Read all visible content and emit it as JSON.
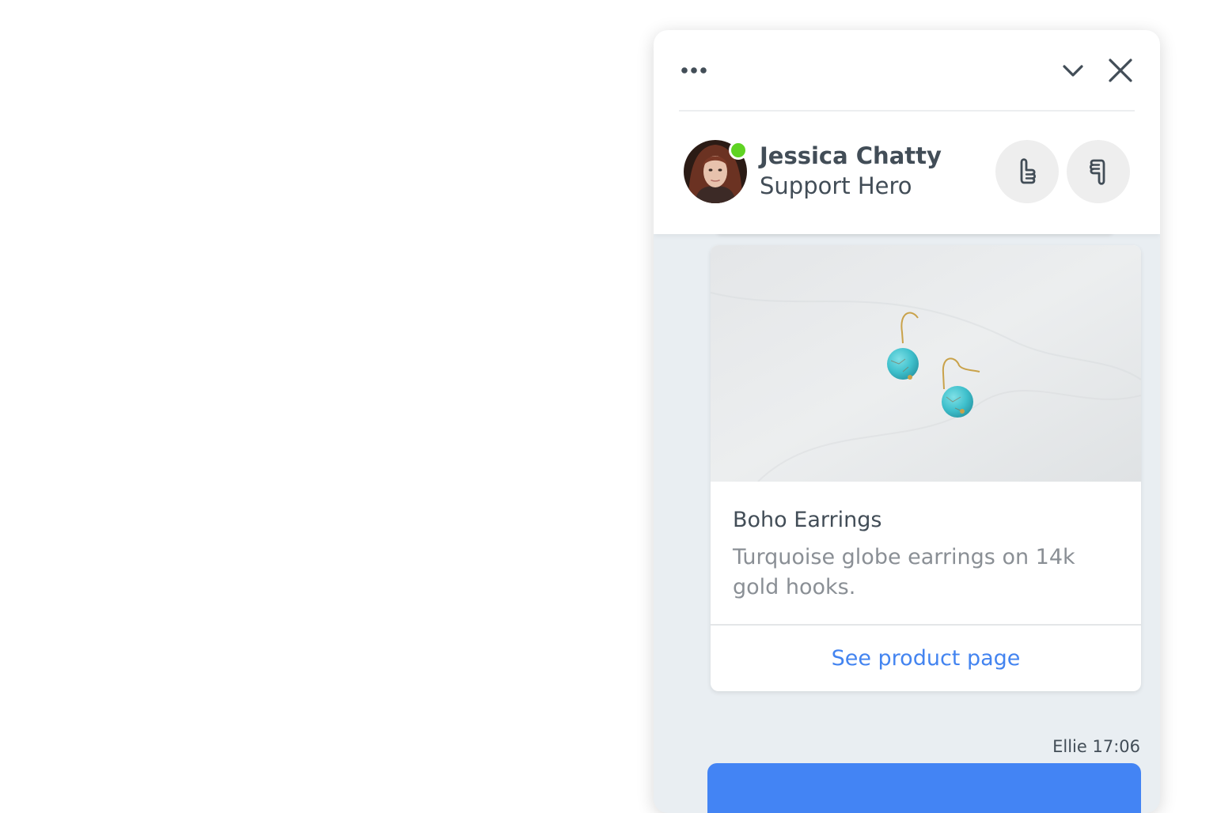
{
  "header": {
    "menu_icon": "more-horizontal-icon",
    "minimize_icon": "chevron-down-icon",
    "close_icon": "close-icon"
  },
  "agent": {
    "name": "Jessica Chatty",
    "role": "Support Hero",
    "status": "online",
    "status_color": "#5fd323"
  },
  "rating": {
    "thumbs_up_icon": "thumbs-up-icon",
    "thumbs_down_icon": "thumbs-down-icon"
  },
  "product_card": {
    "title": "Boho Earrings",
    "description": "Turquoise globe earrings on 14k gold hooks.",
    "link_label": "See product page"
  },
  "message": {
    "meta": "Ellie 17:06"
  },
  "colors": {
    "accent": "#4384f4",
    "text_primary": "#424d57",
    "text_secondary": "#8a8f95",
    "chat_background": "#e9eef2"
  }
}
